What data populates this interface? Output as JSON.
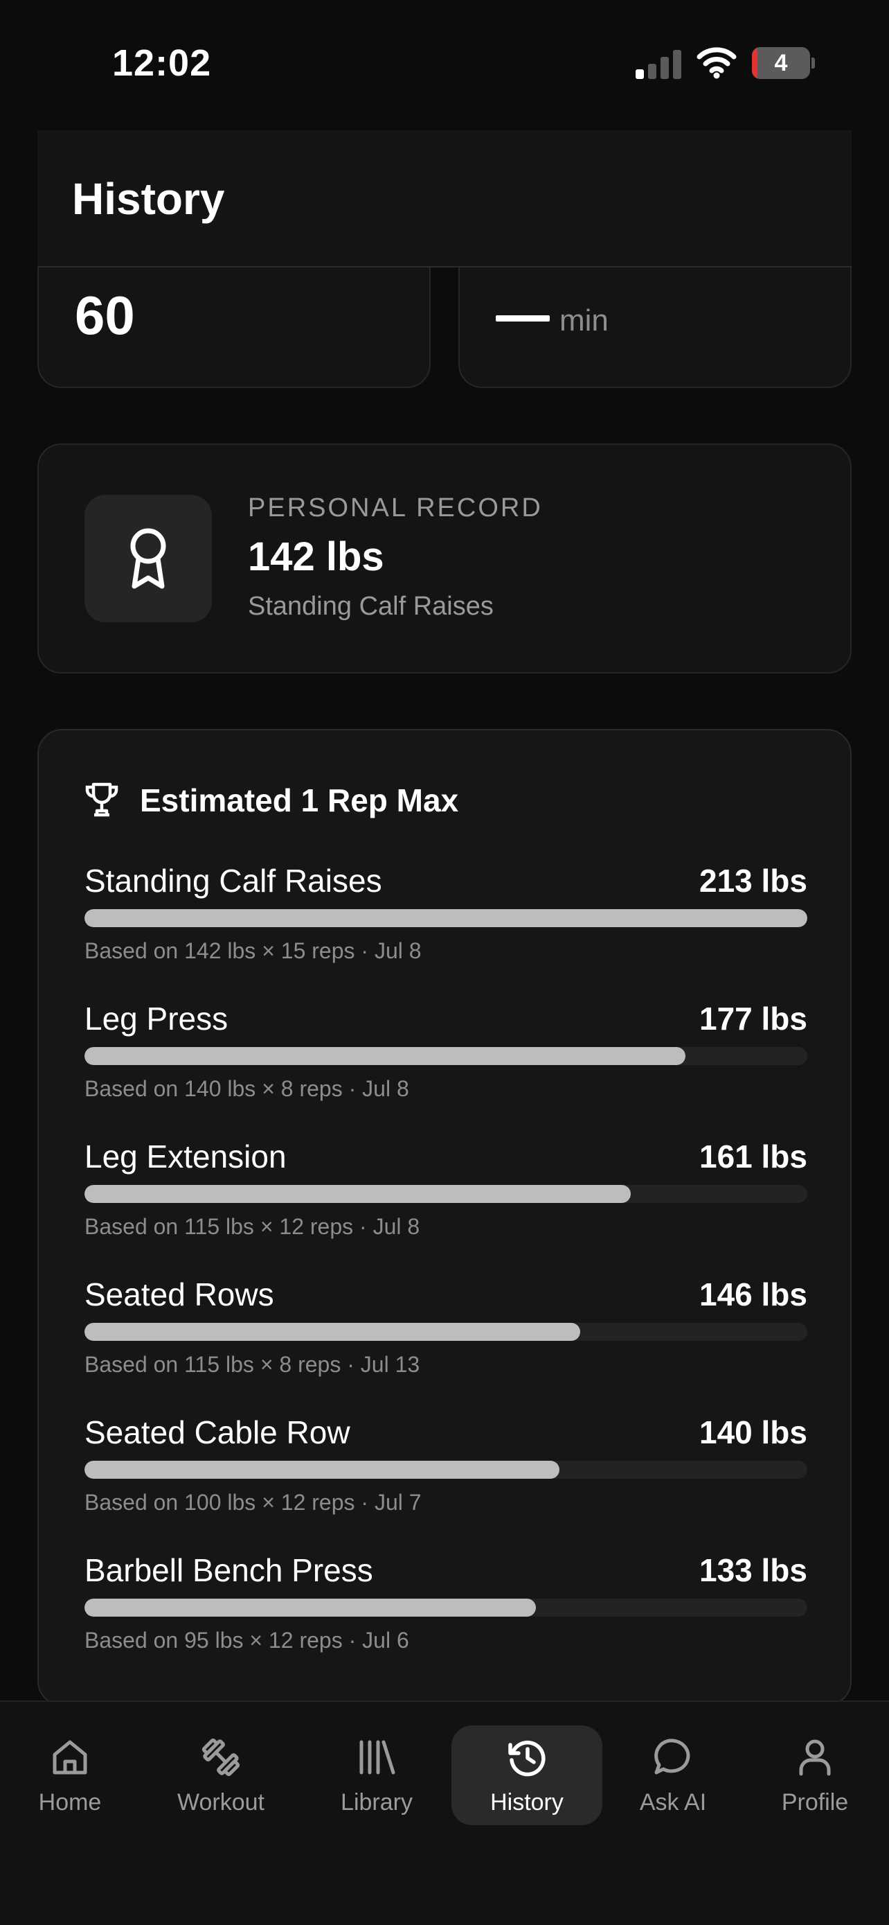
{
  "status_bar": {
    "time": "12:02",
    "battery_level": "4",
    "icons": [
      "cellular-signal-icon",
      "wifi-icon",
      "battery-icon"
    ]
  },
  "header": {
    "title": "History"
  },
  "stats": {
    "left_value": "60",
    "right_value": "—",
    "right_unit": "min"
  },
  "personal_record": {
    "label": "PERSONAL RECORD",
    "value": "142 lbs",
    "exercise": "Standing Calf Raises",
    "icon": "award-ribbon-icon"
  },
  "one_rep_max": {
    "title": "Estimated 1 Rep Max",
    "icon": "trophy-icon",
    "items": [
      {
        "name": "Standing Calf Raises",
        "value": "213 lbs",
        "detail": "Based on 142 lbs × 15 reps · Jul 8",
        "estimate_lbs": 213
      },
      {
        "name": "Leg Press",
        "value": "177 lbs",
        "detail": "Based on 140 lbs × 8 reps · Jul 8",
        "estimate_lbs": 177
      },
      {
        "name": "Leg Extension",
        "value": "161 lbs",
        "detail": "Based on 115 lbs × 12 reps · Jul 8",
        "estimate_lbs": 161
      },
      {
        "name": "Seated Rows",
        "value": "146 lbs",
        "detail": "Based on 115 lbs × 8 reps · Jul 13",
        "estimate_lbs": 146
      },
      {
        "name": "Seated Cable Row",
        "value": "140 lbs",
        "detail": "Based on 100 lbs × 12 reps · Jul 7",
        "estimate_lbs": 140
      },
      {
        "name": "Barbell Bench Press",
        "value": "133 lbs",
        "detail": "Based on 95 lbs × 12 reps · Jul 6",
        "estimate_lbs": 133
      }
    ]
  },
  "tabbar": {
    "active": "History",
    "tabs": [
      {
        "label": "Home",
        "icon": "home-icon"
      },
      {
        "label": "Workout",
        "icon": "dumbbell-icon"
      },
      {
        "label": "Library",
        "icon": "library-icon"
      },
      {
        "label": "History",
        "icon": "history-icon"
      },
      {
        "label": "Ask AI",
        "icon": "chat-bubble-icon"
      },
      {
        "label": "Profile",
        "icon": "user-icon"
      }
    ]
  },
  "colors": {
    "background": "#0c0c0c",
    "card": "#161616",
    "bar_fill": "#bdbdbd",
    "bar_track": "#232323",
    "muted_text": "#8d8d8d",
    "battery_low": "#e2332f"
  }
}
